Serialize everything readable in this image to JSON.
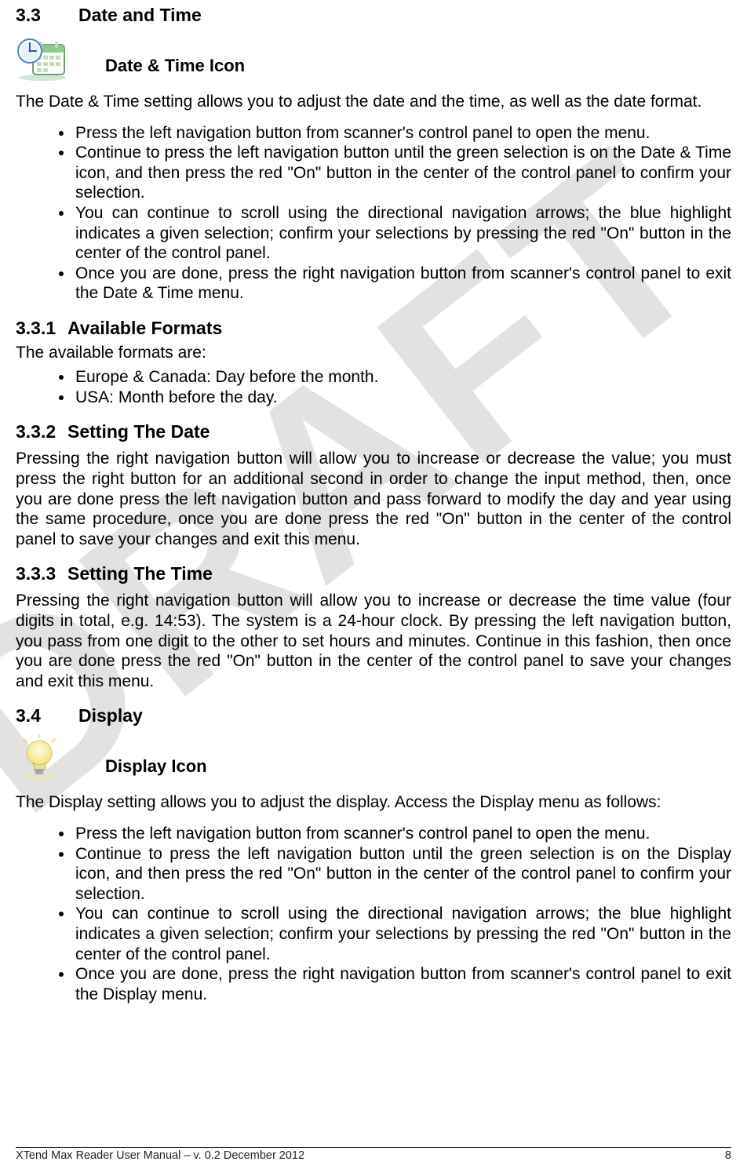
{
  "section33": {
    "num": "3.3",
    "title": "Date and Time",
    "icon_label": "Date & Time Icon",
    "intro": "The Date & Time setting allows you to adjust the date and the time, as well as the date format.",
    "bullets": [
      "Press the left navigation button from scanner's control panel to open the menu.",
      "Continue to press the left navigation button until the green selection is on the Date & Time icon, and then press the red \"On\" button in the center of the control panel to confirm your selection.",
      "You can continue to scroll using the directional navigation arrows; the blue highlight indicates a given selection; confirm your selections by pressing the red \"On\" button in the center of the control panel.",
      "Once you are done, press the right navigation button from scanner's control panel to exit the Date & Time menu."
    ]
  },
  "section331": {
    "num": "3.3.1",
    "title": "Available Formats",
    "lead": "The available formats are:",
    "bullets": [
      "Europe & Canada: Day before the month.",
      "USA: Month before the day."
    ]
  },
  "section332": {
    "num": "3.3.2",
    "title": "Setting The Date",
    "body": "Pressing the right navigation button will allow you to increase or decrease the value; you must press the right button for an additional second in order to change the input method, then, once you are done press the left navigation button and pass forward to modify the day and year using the same procedure, once you are done press the red \"On\" button in the center of the control panel to save your changes and exit this menu."
  },
  "section333": {
    "num": "3.3.3",
    "title": "Setting The Time",
    "body": "Pressing the right navigation button will allow you to increase or decrease the time value (four digits in total, e.g. 14:53). The system is a 24-hour clock. By pressing the left navigation button, you pass from one digit to the other to set hours and minutes. Continue in this fashion, then once you are done press the red \"On\" button in the center of the control panel to save your changes and exit this menu."
  },
  "section34": {
    "num": "3.4",
    "title": "Display",
    "icon_label": "Display Icon",
    "intro": "The Display setting allows you to adjust the display. Access the Display menu as follows:",
    "bullets": [
      "Press the left navigation button from scanner's control panel to open the menu.",
      "Continue to press the left navigation button until the green selection is on the Display icon, and then press the red \"On\" button in the center of the control panel to confirm your selection.",
      "You can continue to scroll using the directional navigation arrows; the blue highlight indicates a given selection; confirm your selections by pressing the red \"On\" button in the center of the control panel.",
      "Once you are done, press the right navigation button from scanner's control panel to exit the Display menu."
    ]
  },
  "footer": {
    "left": "XTend Max Reader User Manual – v. 0.2 December 2012",
    "right": "8"
  }
}
